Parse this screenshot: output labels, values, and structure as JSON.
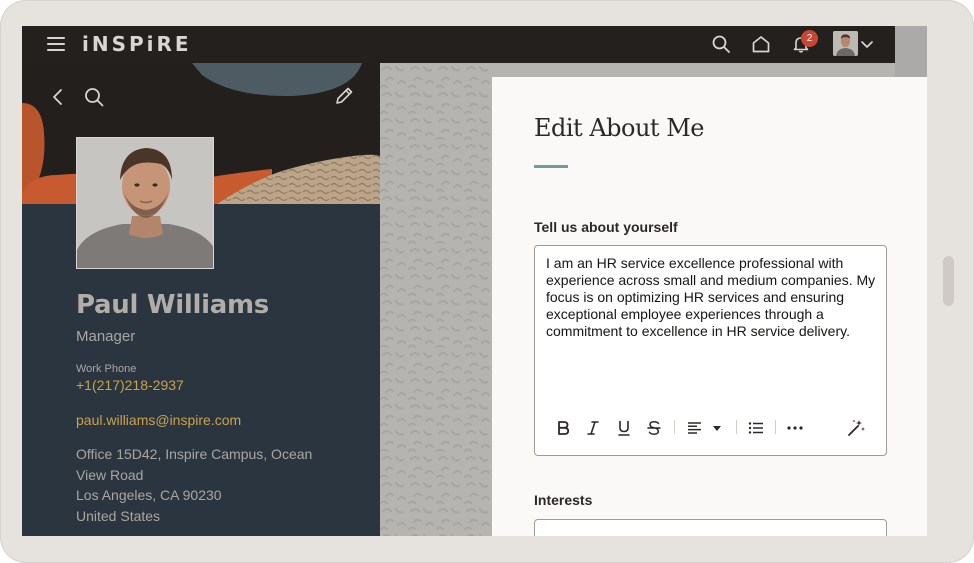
{
  "app": {
    "logo_text": "iNSPiRE",
    "notification_count": "2",
    "accent_color": "#c74634"
  },
  "topbar": {
    "icons": [
      "hamburger-icon",
      "search-icon",
      "home-icon",
      "bell-icon",
      "avatar",
      "chevron-down-icon"
    ]
  },
  "profile": {
    "name": "Paul Williams",
    "title": "Manager",
    "work_phone_label": "Work Phone",
    "work_phone": "+1(217)218-2937",
    "email": "paul.williams@inspire.com",
    "address_lines": [
      "Office 15D42, Inspire Campus, Ocean",
      "View Road",
      "Los Angeles, CA 90230",
      "United States"
    ],
    "link_color": "#c9a24a"
  },
  "drawer": {
    "title": "Edit About Me",
    "about_label": "Tell us about yourself",
    "about_text": "I am an HR service excellence professional with experience across small and medium companies. My focus is on optimizing HR services and ensuring exceptional employee experiences through a commitment to excellence in HR service delivery.",
    "interests_label": "Interests",
    "toolbar_icons": [
      "bold-icon",
      "italic-icon",
      "underline-icon",
      "strikethrough-icon",
      "align-left-icon",
      "caret-down-icon",
      "list-icon",
      "more-icon",
      "magic-wand-icon"
    ]
  }
}
